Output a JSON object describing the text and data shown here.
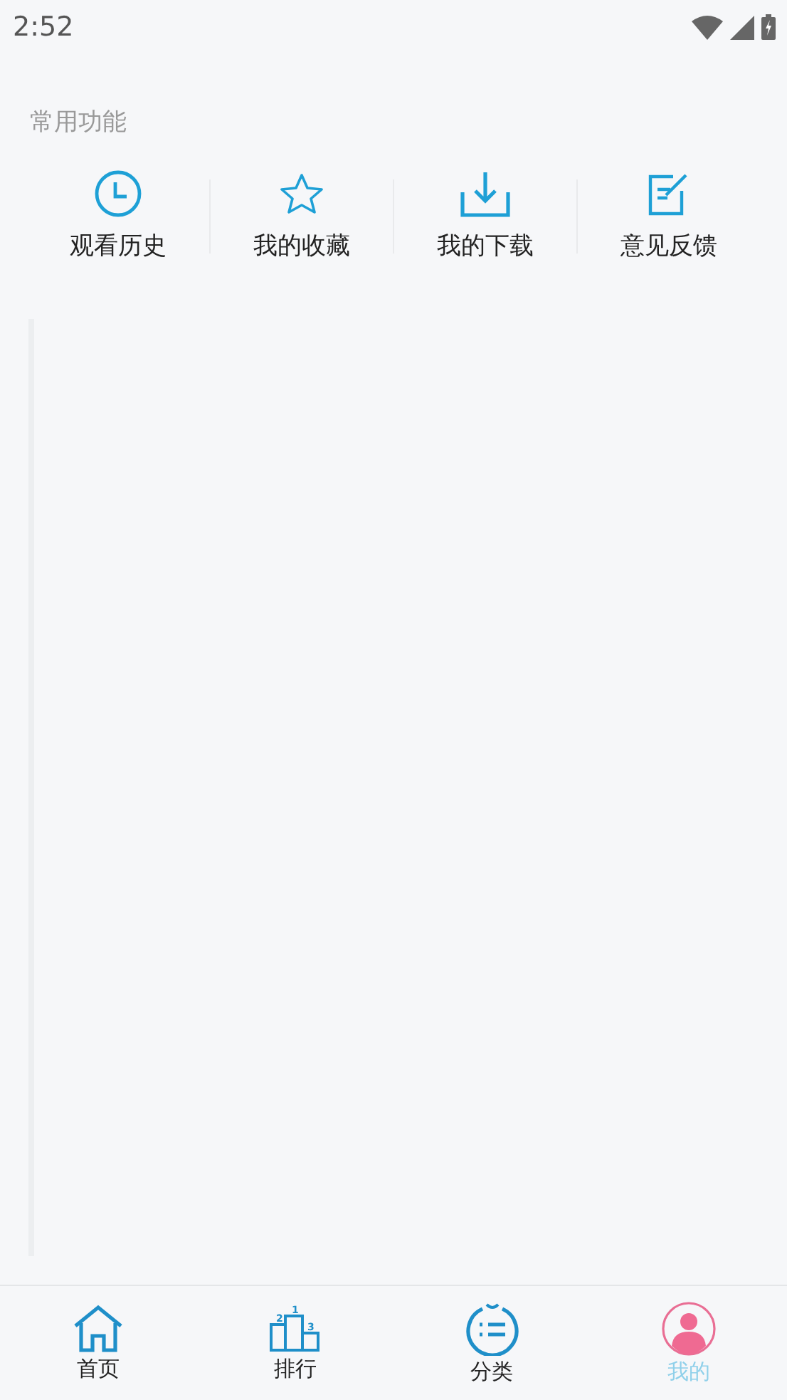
{
  "status_bar": {
    "time": "2:52"
  },
  "section": {
    "title": "常用功能",
    "items": [
      {
        "kind": "history",
        "label": "观看历史"
      },
      {
        "kind": "favorite",
        "label": "我的收藏"
      },
      {
        "kind": "download",
        "label": "我的下载"
      },
      {
        "kind": "feedback",
        "label": "意见反馈"
      }
    ]
  },
  "tabs": [
    {
      "kind": "home",
      "label": "首页",
      "selected": false
    },
    {
      "kind": "rank",
      "label": "排行",
      "selected": false,
      "icon_digits": [
        "1",
        "2",
        "3"
      ]
    },
    {
      "kind": "category",
      "label": "分类",
      "selected": false
    },
    {
      "kind": "profile",
      "label": "我的",
      "selected": true
    }
  ]
}
